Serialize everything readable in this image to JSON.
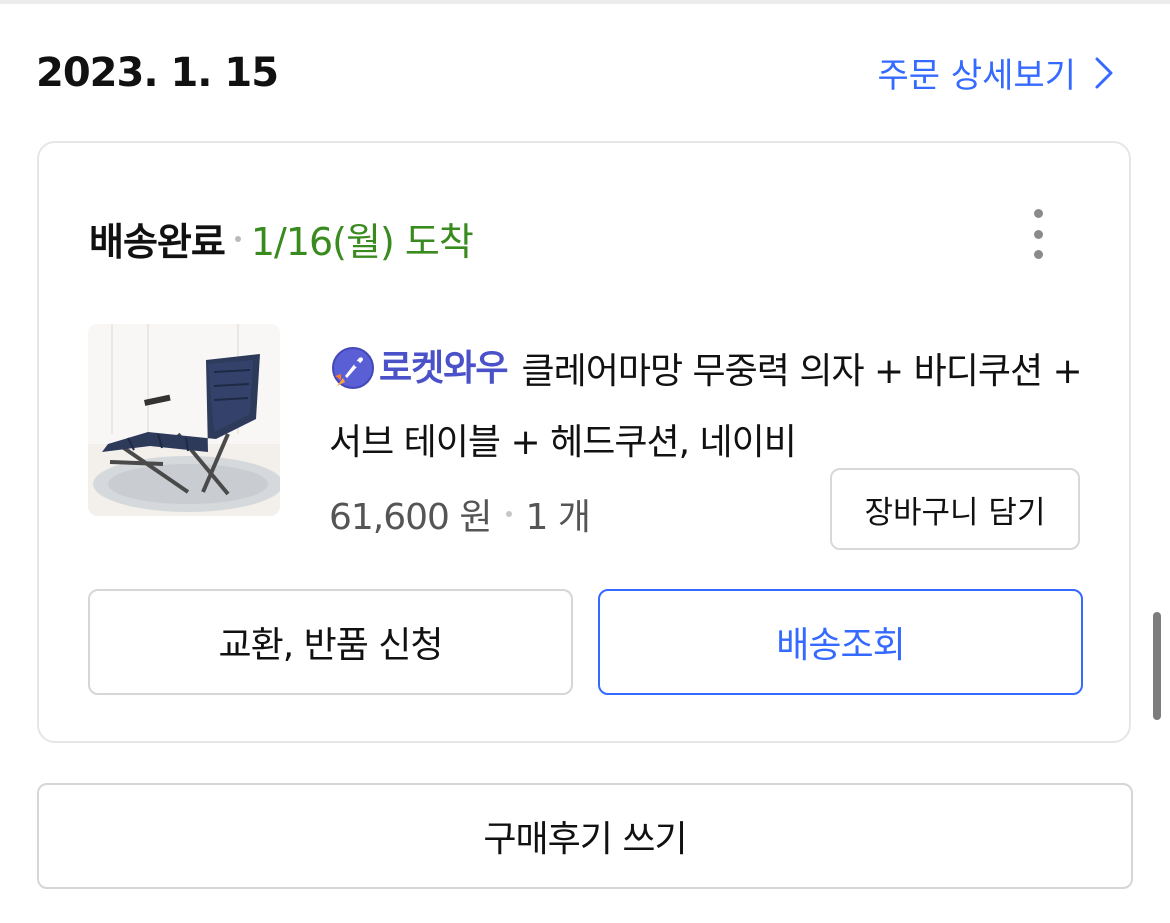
{
  "order": {
    "date": "2023. 1. 15",
    "detail_link_label": "주문 상세보기"
  },
  "shipment": {
    "status": "배송완료",
    "arrival": "1/16(월) 도착"
  },
  "product": {
    "badge": "로켓와우",
    "title": "클레어마망 무중력 의자 + 바디쿠션 + 서브 테이블 + 헤드쿠션, 네이비",
    "price": "61,600 원",
    "quantity": "1 개",
    "thumbnail_icon": "reclining-chair-image"
  },
  "buttons": {
    "add_to_cart": "장바구니 담기",
    "exchange_return": "교환, 반품 신청",
    "track_delivery": "배송조회",
    "write_review": "구매후기 쓰기"
  },
  "icons": {
    "detail": "chevron-right-icon",
    "more": "kebab-menu-icon",
    "badge": "rocket-icon"
  },
  "colors": {
    "accent_blue": "#346aff",
    "arrival_green": "#3a8b1f",
    "badge_purple": "#4a51c9"
  }
}
